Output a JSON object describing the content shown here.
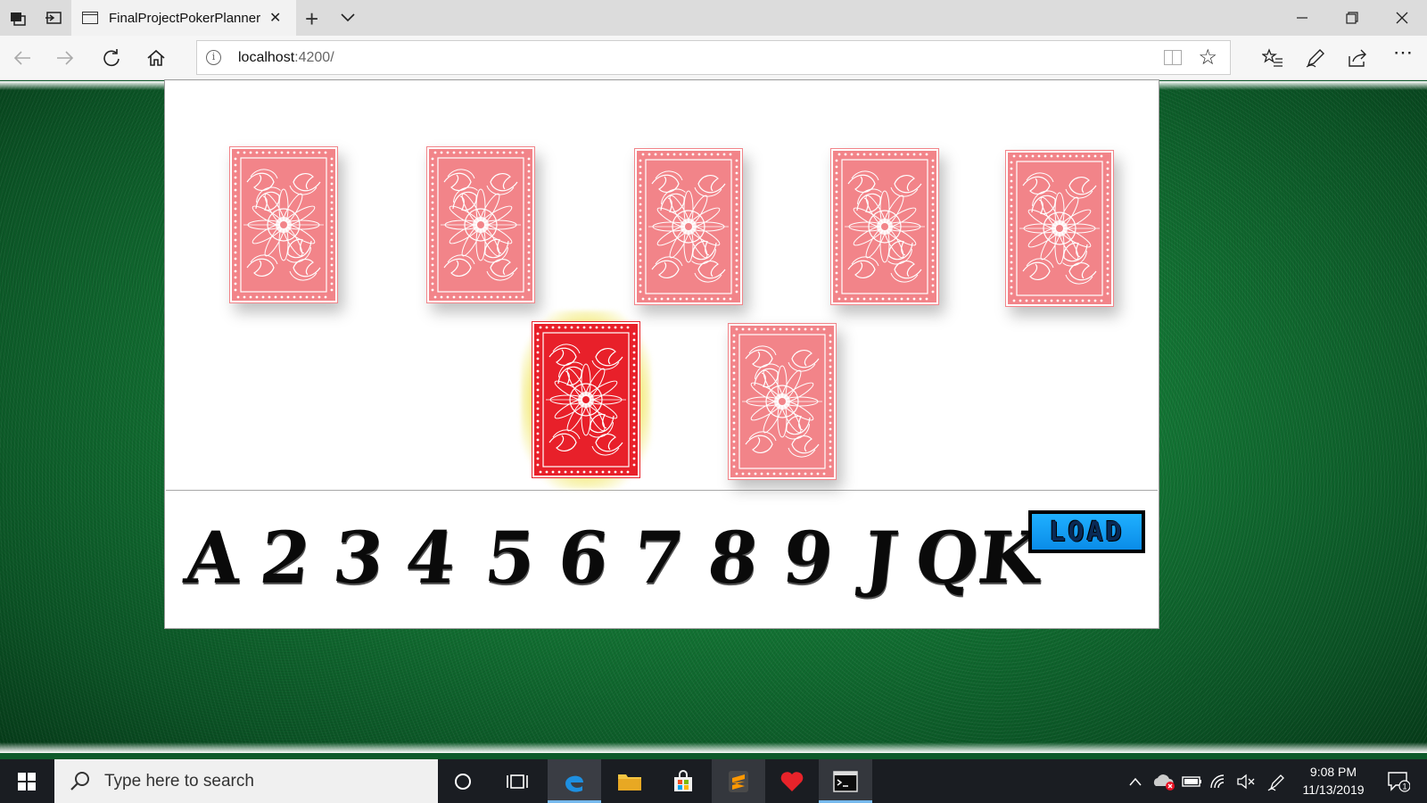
{
  "browser": {
    "tab_title": "FinalProjectPokerPlanner",
    "url_host": "localhost",
    "url_rest": ":4200/"
  },
  "board": {
    "cards": [
      {
        "state": "faded"
      },
      {
        "state": "faded"
      },
      {
        "state": "faded"
      },
      {
        "state": "faded"
      },
      {
        "state": "faded"
      },
      {
        "state": "selected"
      },
      {
        "state": "faded"
      }
    ],
    "card_back_color": "#e8202a",
    "highlight_color": "#f0e650"
  },
  "ranks": [
    "A",
    "2",
    "3",
    "4",
    "5",
    "6",
    "7",
    "8",
    "9",
    "J",
    "Q",
    "K"
  ],
  "load_label": "LOAD",
  "taskbar": {
    "search_placeholder": "Type here to search",
    "time": "9:08 PM",
    "date": "11/13/2019",
    "notification_count": "1"
  }
}
